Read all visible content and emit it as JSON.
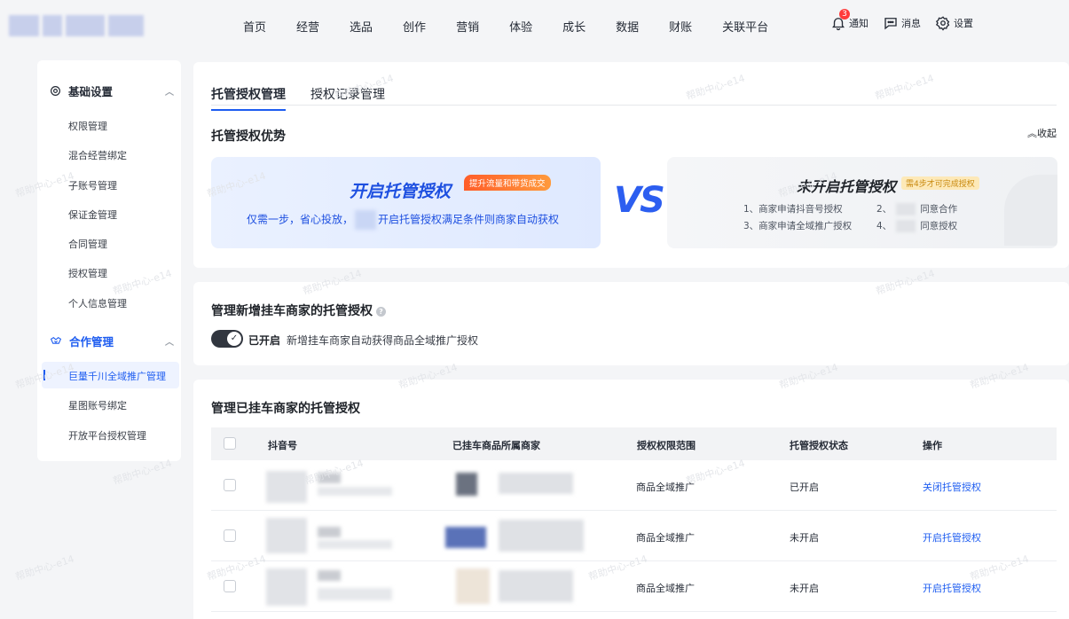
{
  "topnav": {
    "items": [
      "首页",
      "经营",
      "选品",
      "创作",
      "营销",
      "体验",
      "成长",
      "数据",
      "财账",
      "关联平台"
    ],
    "notify_label": "通知",
    "notify_count": "3",
    "message_label": "消息",
    "settings_label": "设置"
  },
  "sidebar": {
    "group1_label": "基础设置",
    "group1_items": [
      "权限管理",
      "混合经营绑定",
      "子账号管理",
      "保证金管理",
      "合同管理",
      "授权管理",
      "个人信息管理"
    ],
    "group2_label": "合作管理",
    "group2_items": [
      "巨量千川全域推广管理",
      "星图账号绑定",
      "开放平台授权管理"
    ],
    "active_item": "巨量千川全域推广管理"
  },
  "tabs": [
    "托管授权管理",
    "授权记录管理"
  ],
  "advantage": {
    "title": "托管授权优势",
    "collapse_label": "收起",
    "left_title": "开启托管授权",
    "left_tag": "提升流量和带货成交",
    "left_desc_prefix": "仅需一步，省心投放，",
    "left_desc_suffix": "开启托管授权满足条件则商家自动获权",
    "vs": "VS",
    "right_title": "未开启托管授权",
    "right_tag": "需4步才可完成授权",
    "steps": [
      "1、商家申请抖音号授权",
      "2、",
      "同意合作",
      "3、商家申请全域推广授权",
      "4、",
      "同意授权"
    ]
  },
  "new_merchant": {
    "title": "管理新增挂车商家的托管授权",
    "help": "?",
    "toggle_state": "已开启",
    "toggle_on": true,
    "description": "新增挂车商家自动获得商品全域推广授权"
  },
  "existing": {
    "title": "管理已挂车商家的托管授权",
    "columns": [
      "抖音号",
      "已挂车商品所属商家",
      "授权权限范围",
      "托管授权状态",
      "操作"
    ],
    "rows": [
      {
        "scope": "商品全域推广",
        "status": "已开启",
        "action": "关闭托管授权"
      },
      {
        "scope": "商品全域推广",
        "status": "未开启",
        "action": "开启托管授权"
      },
      {
        "scope": "商品全域推广",
        "status": "未开启",
        "action": "开启托管授权"
      }
    ]
  },
  "watermark": "帮助中心-e14",
  "colors": {
    "accent": "#1d5cf0",
    "badge": "#ff3b3b",
    "toggle": "#31363f"
  }
}
